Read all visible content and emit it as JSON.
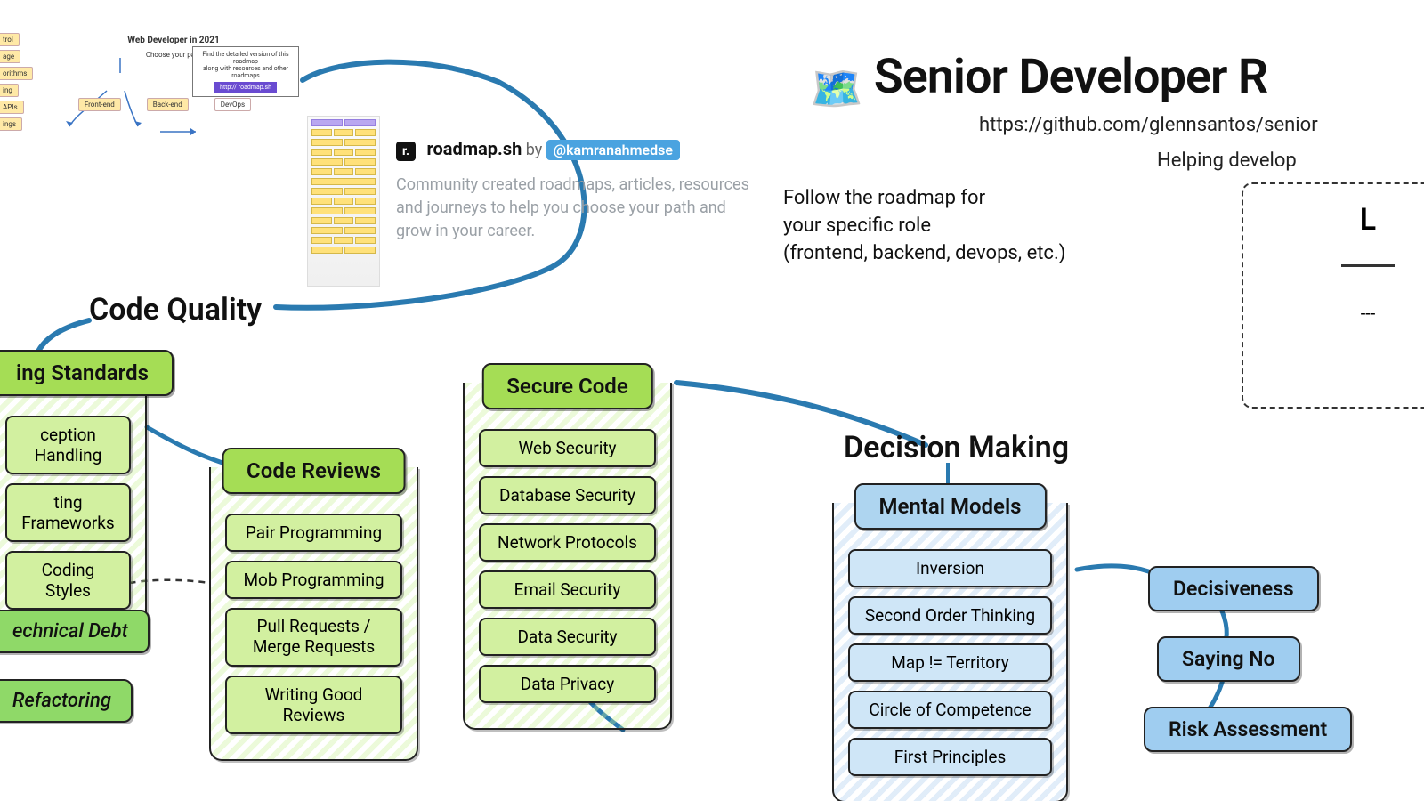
{
  "header": {
    "icon": "🗺️",
    "title": "Senior Developer R",
    "url": "https://github.com/glennsantos/senior",
    "tagline": "Helping develop"
  },
  "legend": {
    "title": "L",
    "optional_prefix": "--- "
  },
  "follow": {
    "line1": "Follow the roadmap for",
    "line2": "your specific role",
    "line3": "(frontend, backend, devops, etc.)"
  },
  "code_quality": {
    "heading": "Code Quality",
    "coding_standards": {
      "head": "ing Standards",
      "items": [
        "ception Handling",
        "ting Frameworks",
        "Coding Styles"
      ]
    },
    "code_reviews": {
      "head": "Code Reviews",
      "items": [
        "Pair Programming",
        "Mob Programming",
        "Pull Requests /\nMerge Requests",
        "Writing Good Reviews"
      ]
    },
    "secure_code": {
      "head": "Secure Code",
      "items": [
        "Web Security",
        "Database Security",
        "Network Protocols",
        "Email Security",
        "Data Security",
        "Data Privacy"
      ]
    },
    "pills": {
      "tech_debt": "echnical Debt",
      "refactoring": "Refactoring"
    }
  },
  "decision_making": {
    "heading": "Decision Making",
    "mental_models": {
      "head": "Mental Models",
      "items": [
        "Inversion",
        "Second Order Thinking",
        "Map != Territory",
        "Circle of Competence",
        "First Principles"
      ]
    },
    "side_pills": [
      "Decisiveness",
      "Saying No",
      "Risk Assessment"
    ]
  },
  "roadmapsh": {
    "site": "roadmap.sh",
    "by": "by",
    "author": "@kamranahmedse",
    "desc": "Community created roadmaps, articles, resources and journeys to help you choose your path and grow in your career."
  },
  "inset2021": {
    "title": "Web Developer in 2021",
    "choose": "Choose your path",
    "paths": [
      "Front-end",
      "Back-end",
      "DevOps"
    ],
    "note_line1": "Find the detailed version of this roadmap",
    "note_line2": "along with resources and other roadmaps",
    "note_link": "http:// roadmap.sh",
    "side_tags": [
      "trol",
      "age",
      "orithms",
      "ing",
      "APIs",
      "ings"
    ]
  }
}
